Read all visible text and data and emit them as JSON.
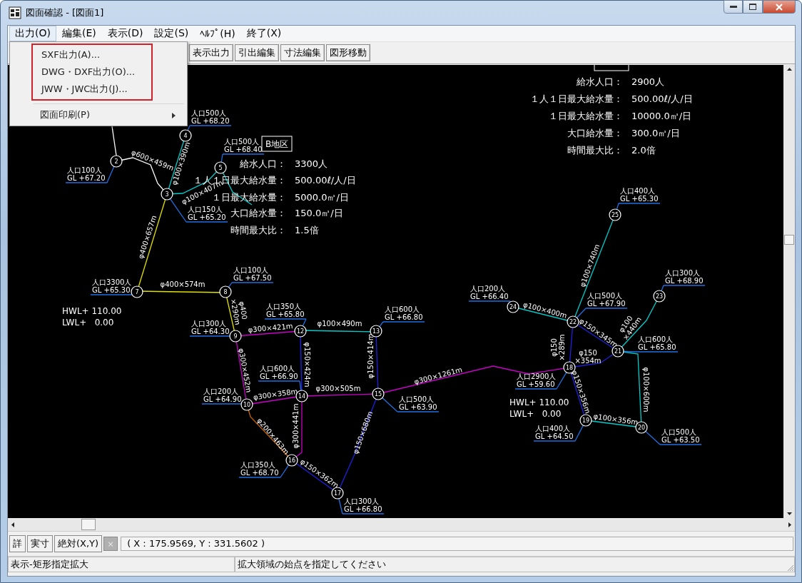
{
  "window": {
    "title": "図面確認 - [図面1]"
  },
  "menu_bar": [
    {
      "label": "出力(O)",
      "selected": true
    },
    {
      "label": "編集(E)",
      "selected": false
    },
    {
      "label": "表示(D)",
      "selected": false
    },
    {
      "label": "設定(S)",
      "selected": false
    },
    {
      "label": "ﾍﾙﾌﾟ(H)",
      "selected": false
    },
    {
      "label": "終了(X)",
      "selected": false
    }
  ],
  "menu": {
    "items": [
      {
        "label": "SXF出力(A)...",
        "highlighted": true,
        "submenu": false
      },
      {
        "label": "DWG・DXF出力(O)...",
        "highlighted": true,
        "submenu": false
      },
      {
        "label": "JWW・JWC出力(J)...",
        "highlighted": true,
        "submenu": false
      },
      {
        "label": "図面印刷(P)",
        "highlighted": false,
        "submenu": true
      }
    ]
  },
  "toolbar": {
    "buttons": [
      "表示出力",
      "引出編集",
      "寸法編集",
      "図形移動"
    ]
  },
  "drawing": {
    "districts": [
      {
        "name": "B地区",
        "items": [
          {
            "key": "給水人口：",
            "value": "3300人"
          },
          {
            "key": "１人１日最大給水量：",
            "value": "500.00ℓ/人/日"
          },
          {
            "key": "１日最大給水量：",
            "value": "5000.0㎥/日"
          },
          {
            "key": "大口給水量：",
            "value": "150.0㎥/日"
          },
          {
            "key": "時間最大比：",
            "value": "1.5倍"
          }
        ]
      },
      {
        "items": [
          {
            "key": "給水人口：",
            "value": "2900人"
          },
          {
            "key": "１人１日最大給水量：",
            "value": "500.00ℓ/人/日"
          },
          {
            "key": "１日最大給水量：",
            "value": "10000.0㎥/日"
          },
          {
            "key": "大口給水量：",
            "value": "300.0㎥/日"
          },
          {
            "key": "時間最大比：",
            "value": "2.0倍"
          }
        ]
      }
    ],
    "nodes": [
      {
        "number": "4",
        "population": "人口500人",
        "gl": "GL +68.20"
      },
      {
        "number": "2",
        "population": "人口100人",
        "gl": "GL +67.20"
      },
      {
        "number": "5",
        "population": "人口500人",
        "gl": "GL +68.40"
      },
      {
        "number": "3",
        "population": "人口150人",
        "gl": "GL +65.20"
      },
      {
        "number": "25",
        "population": "人口400人",
        "gl": "GL +65.30"
      },
      {
        "number": "7",
        "population": "人口3300人",
        "gl": "GL +65.30"
      },
      {
        "number": "8",
        "population": "人口100人",
        "gl": "GL +67.50"
      },
      {
        "number": "23",
        "population": "人口300人",
        "gl": "GL +68.90"
      },
      {
        "number": "24",
        "population": "人口200人",
        "gl": "GL +66.40"
      },
      {
        "number": "22",
        "population": "人口500人",
        "gl": "GL +67.90"
      },
      {
        "number": "12",
        "population": "人口350人",
        "gl": "GL +65.80"
      },
      {
        "number": "13",
        "population": "人口600人",
        "gl": "GL +66.80"
      },
      {
        "number": "9",
        "population": "人口300人",
        "gl": "GL +64.30"
      },
      {
        "number": "21",
        "population": "人口600人",
        "gl": "GL +65.80"
      },
      {
        "number": "18",
        "population": "人口2900人",
        "gl": "GL +59.60"
      },
      {
        "number": "15",
        "population": "人口500人",
        "gl": "GL +63.90"
      },
      {
        "number": "14",
        "population": "人口600人",
        "gl": "GL +66.90"
      },
      {
        "number": "10",
        "population": "人口200人",
        "gl": "GL +64.90"
      },
      {
        "number": "19",
        "population": "人口400人",
        "gl": "GL +64.50"
      },
      {
        "number": "20",
        "population": "人口500人",
        "gl": "GL +63.50"
      },
      {
        "number": "16",
        "population": "人口350人",
        "gl": "GL +68.70"
      },
      {
        "number": "17",
        "population": "人口300人",
        "gl": "GL +66.80"
      }
    ],
    "pipes": [
      {
        "color": "#ffffff"
      },
      {
        "color": "#ffffff",
        "label": [
          "φ600×459m"
        ]
      },
      {
        "color": "#00cccc",
        "label": [
          "φ100×390m"
        ]
      },
      {
        "color": "#00cccc",
        "label": [
          "φ100×407m"
        ]
      },
      {
        "color": "#00cccc"
      },
      {
        "color": "#e0e000",
        "label": [
          "φ400×657m"
        ]
      },
      {
        "color": "#e0e000",
        "label": [
          "φ400×574m"
        ]
      },
      {
        "color": "#e0e000",
        "label": [
          "φ400",
          "×290m"
        ]
      },
      {
        "color": "#c800c8",
        "label": [
          "φ300×421m"
        ]
      },
      {
        "color": "#00cccc",
        "label": [
          "φ100×490m"
        ]
      },
      {
        "color": "#2020e0",
        "label": [
          "φ150×424m"
        ]
      },
      {
        "color": "#2020e0",
        "label": [
          "φ150×414m"
        ]
      },
      {
        "color": "#c800c8",
        "label": [
          "φ300×452m"
        ]
      },
      {
        "color": "#c800c8",
        "label": [
          "φ300×358m"
        ]
      },
      {
        "color": "#c800c8",
        "label": [
          "φ300×505m"
        ]
      },
      {
        "color": "#c86400",
        "label": [
          "φ200×463m"
        ]
      },
      {
        "color": "#c800c8",
        "label": [
          "φ300×441m"
        ]
      },
      {
        "color": "#2020e0",
        "label": [
          "φ150×362m"
        ]
      },
      {
        "color": "#2020e0",
        "label": [
          "φ150×680m"
        ]
      },
      {
        "color": "#c800c8",
        "label": [
          "φ300×1261m"
        ]
      },
      {
        "color": "#2020e0",
        "label": [
          "φ150",
          "×289m"
        ]
      },
      {
        "color": "#2020e0",
        "label": [
          "φ150",
          "×354m"
        ]
      },
      {
        "color": "#2020e0",
        "label": [
          "φ150×356m"
        ]
      },
      {
        "color": "#00cccc",
        "label": [
          "φ100×356m"
        ]
      },
      {
        "color": "#00cccc",
        "label": [
          "φ100×600m"
        ]
      },
      {
        "color": "#2020e0",
        "label": [
          "φ150×345m"
        ]
      },
      {
        "color": "#00cccc",
        "label": [
          "φ100×400m"
        ]
      },
      {
        "color": "#00cccc",
        "label": [
          "φ100×740m"
        ]
      },
      {
        "color": "#00cccc",
        "label": [
          "φ100",
          "×440m"
        ]
      }
    ],
    "water_levels": [
      {
        "hwl": "HWL+ 110.00",
        "lwl": "LWL+   0.00"
      },
      {
        "hwl": "HWL+ 110.00",
        "lwl": "LWL+   0.00"
      }
    ]
  },
  "bottom_bar": {
    "buttons": [
      {
        "label": "詳",
        "disabled": false
      },
      {
        "label": "実寸",
        "disabled": false
      },
      {
        "label": "絶対(X,Y)",
        "disabled": false
      },
      {
        "label": "×",
        "disabled": true
      }
    ],
    "coordinates": "( X : 175.9569, Y : 331.5602 )"
  },
  "status_bar": [
    "表示-矩形指定拡大",
    "拡大領域の始点を指定してください"
  ]
}
